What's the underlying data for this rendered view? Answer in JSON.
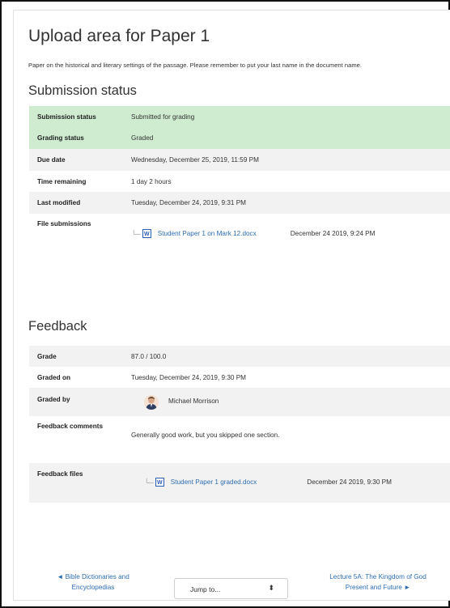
{
  "page": {
    "title": "Upload area for Paper 1",
    "intro": "Paper on the historical and literary settings of the passage. Please remember to put your last name in the document name."
  },
  "submission": {
    "heading": "Submission status",
    "rows": [
      {
        "label": "Submission status",
        "value": "Submitted for grading"
      },
      {
        "label": "Grading status",
        "value": "Graded"
      },
      {
        "label": "Due date",
        "value": "Wednesday, December 25, 2019, 11:59 PM"
      },
      {
        "label": "Time remaining",
        "value": "1 day 2 hours"
      },
      {
        "label": "Last modified",
        "value": "Tuesday, December 24, 2019, 9:31 PM"
      }
    ],
    "files_label": "File submissions",
    "file": {
      "name": "Student Paper 1 on Mark 12.docx",
      "date": "December 24 2019, 9:24 PM",
      "icon": "word-doc-icon"
    }
  },
  "feedback": {
    "heading": "Feedback",
    "grade_label": "Grade",
    "grade_value": "87.0 / 100.0",
    "graded_on_label": "Graded on",
    "graded_on_value": "Tuesday, December 24, 2019, 9:30 PM",
    "graded_by_label": "Graded by",
    "grader_name": "Michael Morrison",
    "comments_label": "Feedback comments",
    "comments_value": "Generally good work, but you skipped one section.",
    "files_label": "Feedback files",
    "file": {
      "name": "Student Paper 1 graded.docx",
      "date": "December 24 2019, 9:30 PM",
      "icon": "word-doc-icon"
    }
  },
  "navigation": {
    "prev_line1": "◄ Bible Dictionaries and",
    "prev_line2": "Encyclopedias",
    "jump_label": "Jump to...",
    "next_line1": "Lecture 5A: The Kingdom of God",
    "next_line2": "Present and Future ►"
  },
  "colors": {
    "accent_link": "#2d6db0",
    "success_bg": "#cfecd0",
    "row_shade": "#f2f2f2"
  }
}
